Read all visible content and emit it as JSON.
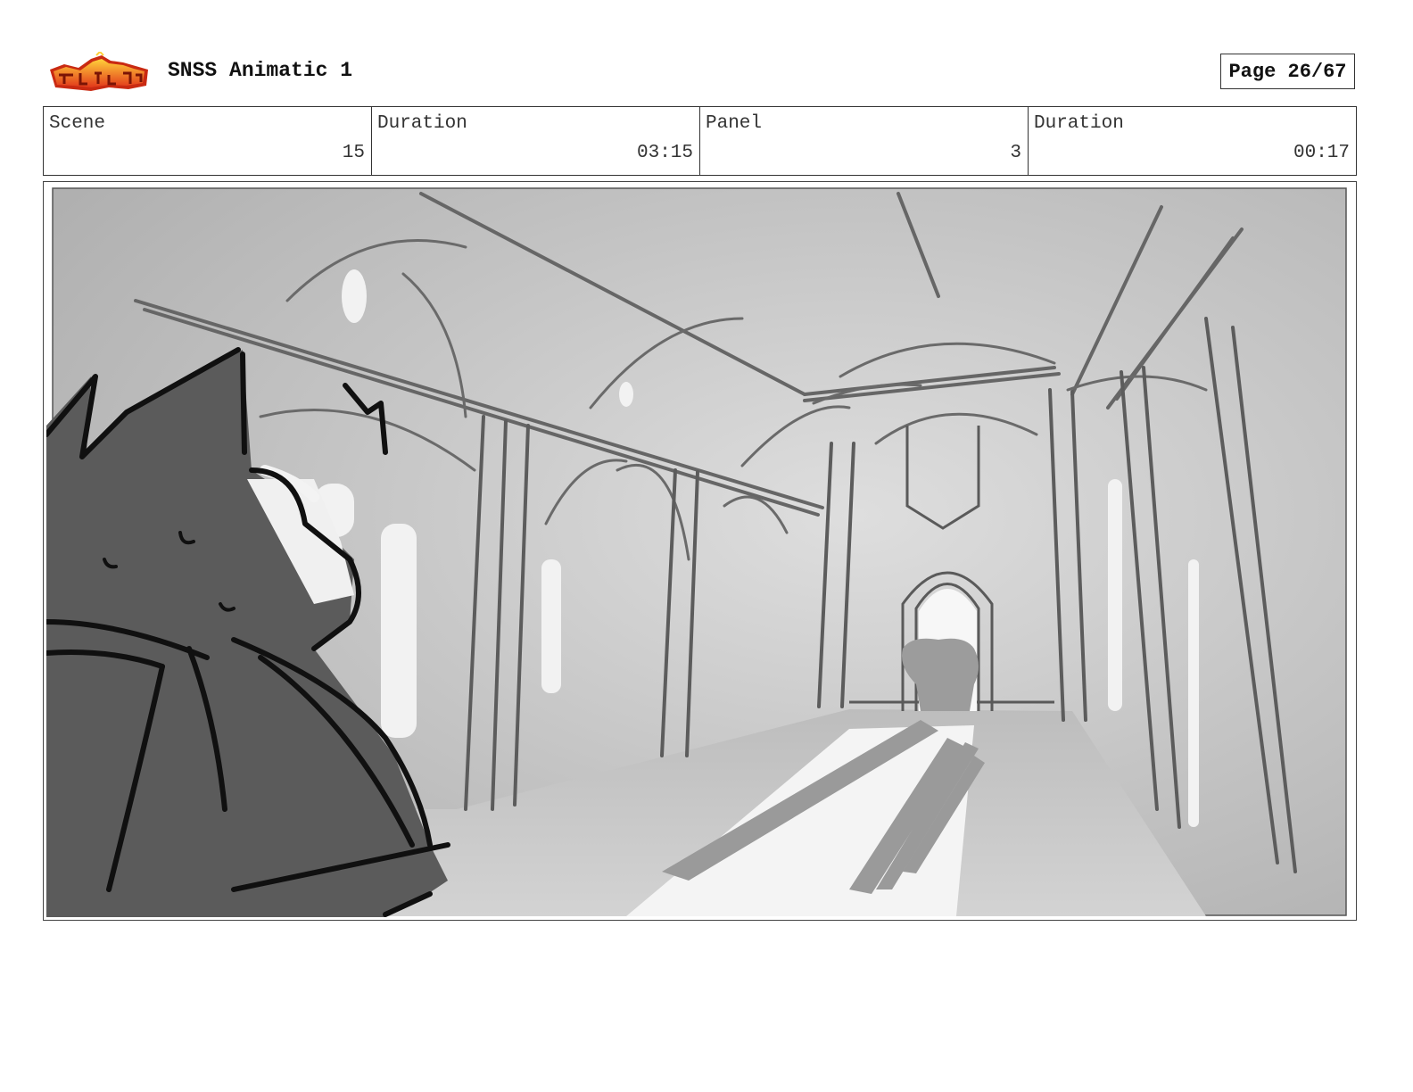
{
  "header": {
    "logo_icon": "sir-foot-so-good-logo",
    "title": "SNSS Animatic 1",
    "page_label": "Page 26/67"
  },
  "info": {
    "scene_label": "Scene",
    "scene_value": "15",
    "scene_duration_label": "Duration",
    "scene_duration_value": "03:15",
    "panel_label": "Panel",
    "panel_value": "3",
    "panel_duration_label": "Duration",
    "panel_duration_value": "00:17"
  },
  "panel": {
    "image_icon": "storyboard-sketch-cathedral-hall-cat"
  }
}
